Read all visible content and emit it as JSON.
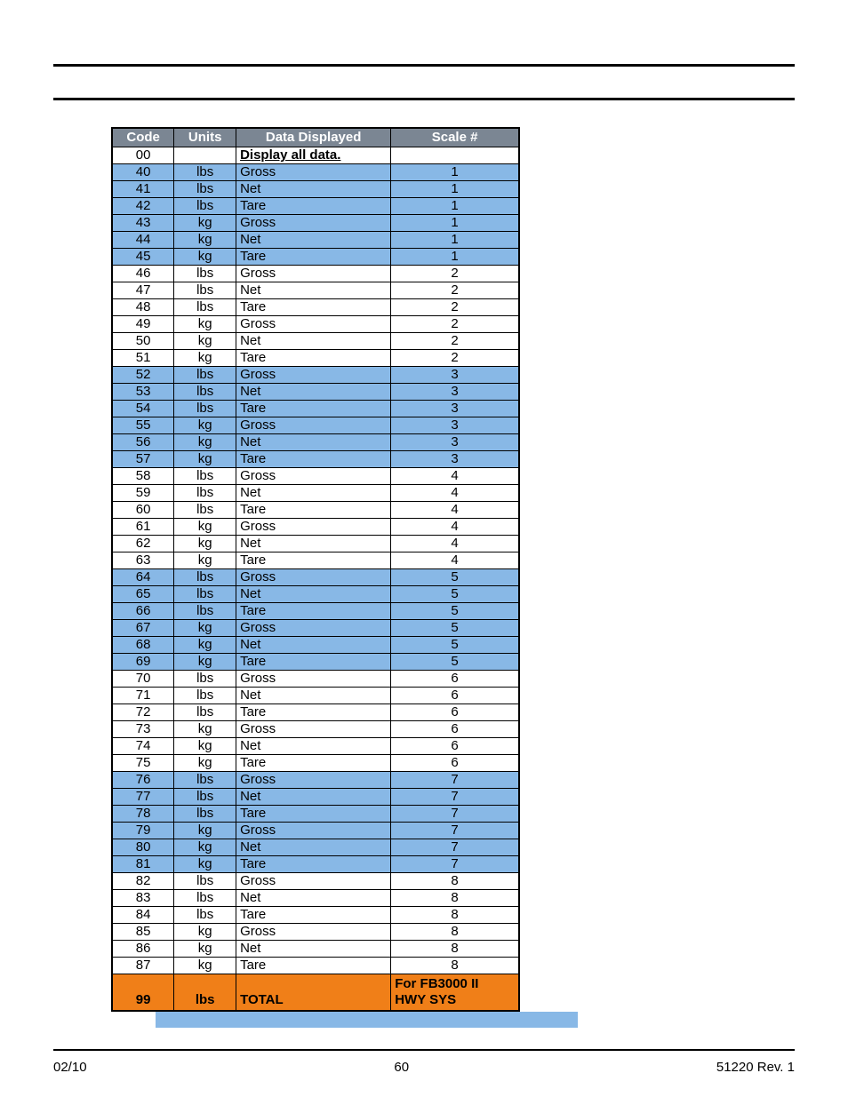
{
  "headers": {
    "code": "Code",
    "units": "Units",
    "data": "Data Displayed",
    "scale": "Scale #"
  },
  "row00": {
    "code": "00",
    "units": "",
    "data": "Display all data.",
    "scale": ""
  },
  "rows": [
    {
      "code": "40",
      "units": "lbs",
      "data": "Gross",
      "scale": "1",
      "shade": true
    },
    {
      "code": "41",
      "units": "lbs",
      "data": "Net",
      "scale": "1",
      "shade": true
    },
    {
      "code": "42",
      "units": "lbs",
      "data": "Tare",
      "scale": "1",
      "shade": true
    },
    {
      "code": "43",
      "units": "kg",
      "data": "Gross",
      "scale": "1",
      "shade": true
    },
    {
      "code": "44",
      "units": "kg",
      "data": "Net",
      "scale": "1",
      "shade": true
    },
    {
      "code": "45",
      "units": "kg",
      "data": "Tare",
      "scale": "1",
      "shade": true
    },
    {
      "code": "46",
      "units": "lbs",
      "data": "Gross",
      "scale": "2",
      "shade": false
    },
    {
      "code": "47",
      "units": "lbs",
      "data": "Net",
      "scale": "2",
      "shade": false
    },
    {
      "code": "48",
      "units": "lbs",
      "data": "Tare",
      "scale": "2",
      "shade": false
    },
    {
      "code": "49",
      "units": "kg",
      "data": "Gross",
      "scale": "2",
      "shade": false
    },
    {
      "code": "50",
      "units": "kg",
      "data": "Net",
      "scale": "2",
      "shade": false
    },
    {
      "code": "51",
      "units": "kg",
      "data": "Tare",
      "scale": "2",
      "shade": false
    },
    {
      "code": "52",
      "units": "lbs",
      "data": "Gross",
      "scale": "3",
      "shade": true
    },
    {
      "code": "53",
      "units": "lbs",
      "data": "Net",
      "scale": "3",
      "shade": true
    },
    {
      "code": "54",
      "units": "lbs",
      "data": "Tare",
      "scale": "3",
      "shade": true
    },
    {
      "code": "55",
      "units": "kg",
      "data": "Gross",
      "scale": "3",
      "shade": true
    },
    {
      "code": "56",
      "units": "kg",
      "data": "Net",
      "scale": "3",
      "shade": true
    },
    {
      "code": "57",
      "units": "kg",
      "data": "Tare",
      "scale": "3",
      "shade": true
    },
    {
      "code": "58",
      "units": "lbs",
      "data": "Gross",
      "scale": "4",
      "shade": false
    },
    {
      "code": "59",
      "units": "lbs",
      "data": "Net",
      "scale": "4",
      "shade": false
    },
    {
      "code": "60",
      "units": "lbs",
      "data": "Tare",
      "scale": "4",
      "shade": false
    },
    {
      "code": "61",
      "units": "kg",
      "data": "Gross",
      "scale": "4",
      "shade": false
    },
    {
      "code": "62",
      "units": "kg",
      "data": "Net",
      "scale": "4",
      "shade": false
    },
    {
      "code": "63",
      "units": "kg",
      "data": "Tare",
      "scale": "4",
      "shade": false
    },
    {
      "code": "64",
      "units": "lbs",
      "data": "Gross",
      "scale": "5",
      "shade": true
    },
    {
      "code": "65",
      "units": "lbs",
      "data": "Net",
      "scale": "5",
      "shade": true
    },
    {
      "code": "66",
      "units": "lbs",
      "data": "Tare",
      "scale": "5",
      "shade": true
    },
    {
      "code": "67",
      "units": "kg",
      "data": "Gross",
      "scale": "5",
      "shade": true
    },
    {
      "code": "68",
      "units": "kg",
      "data": "Net",
      "scale": "5",
      "shade": true
    },
    {
      "code": "69",
      "units": "kg",
      "data": "Tare",
      "scale": "5",
      "shade": true
    },
    {
      "code": "70",
      "units": "lbs",
      "data": "Gross",
      "scale": "6",
      "shade": false
    },
    {
      "code": "71",
      "units": "lbs",
      "data": "Net",
      "scale": "6",
      "shade": false
    },
    {
      "code": "72",
      "units": "lbs",
      "data": "Tare",
      "scale": "6",
      "shade": false
    },
    {
      "code": "73",
      "units": "kg",
      "data": "Gross",
      "scale": "6",
      "shade": false
    },
    {
      "code": "74",
      "units": "kg",
      "data": "Net",
      "scale": "6",
      "shade": false
    },
    {
      "code": "75",
      "units": "kg",
      "data": "Tare",
      "scale": "6",
      "shade": false
    },
    {
      "code": "76",
      "units": "lbs",
      "data": "Gross",
      "scale": "7",
      "shade": true
    },
    {
      "code": "77",
      "units": "lbs",
      "data": "Net",
      "scale": "7",
      "shade": true
    },
    {
      "code": "78",
      "units": "lbs",
      "data": "Tare",
      "scale": "7",
      "shade": true
    },
    {
      "code": "79",
      "units": "kg",
      "data": "Gross",
      "scale": "7",
      "shade": true
    },
    {
      "code": "80",
      "units": "kg",
      "data": "Net",
      "scale": "7",
      "shade": true
    },
    {
      "code": "81",
      "units": "kg",
      "data": "Tare",
      "scale": "7",
      "shade": true
    },
    {
      "code": "82",
      "units": "lbs",
      "data": "Gross",
      "scale": "8",
      "shade": false
    },
    {
      "code": "83",
      "units": "lbs",
      "data": "Net",
      "scale": "8",
      "shade": false
    },
    {
      "code": "84",
      "units": "lbs",
      "data": "Tare",
      "scale": "8",
      "shade": false
    },
    {
      "code": "85",
      "units": "kg",
      "data": "Gross",
      "scale": "8",
      "shade": false
    },
    {
      "code": "86",
      "units": "kg",
      "data": "Net",
      "scale": "8",
      "shade": false
    },
    {
      "code": "87",
      "units": "kg",
      "data": "Tare",
      "scale": "8",
      "shade": false
    }
  ],
  "footerRow": {
    "code": "99",
    "units": "lbs",
    "data": "TOTAL",
    "scale_line1": "For FB3000 II",
    "scale_line2": "HWY SYS"
  },
  "footer": {
    "left": "02/10",
    "center": "60",
    "right": "51220   Rev. 1"
  }
}
